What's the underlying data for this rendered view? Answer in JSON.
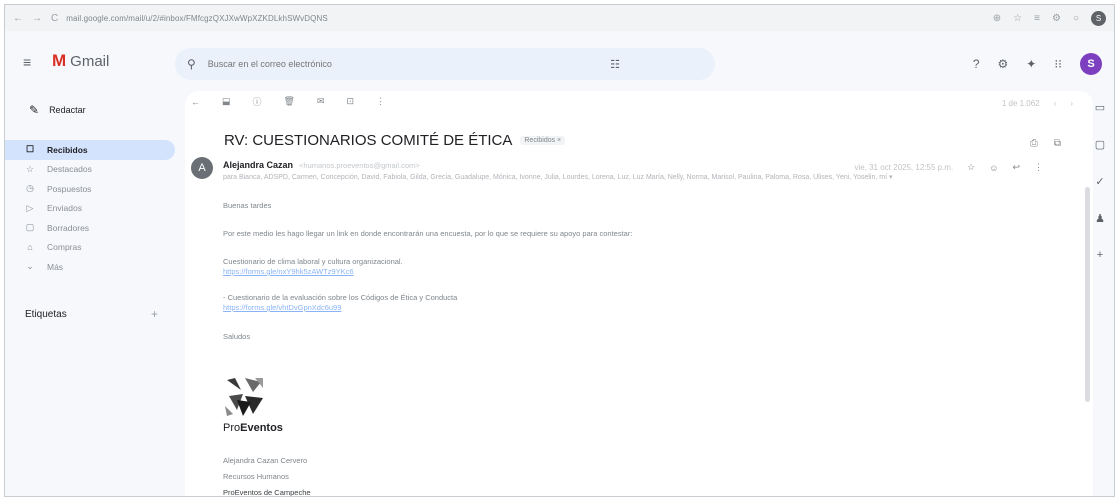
{
  "browser": {
    "url": "mail.google.com/mail/u/2/#inbox/FMfcgzQXJXwWpXZKDLkhSWvDQNS",
    "nav": [
      "←",
      "→",
      "C"
    ],
    "tools": [
      "⊕",
      "☆",
      "≡",
      "⚙",
      "○"
    ],
    "profile": "S"
  },
  "header": {
    "app_name": "Gmail",
    "search_placeholder": "Buscar en el correo electrónico",
    "user_initial": "S"
  },
  "sidebar": {
    "compose_label": "Redactar",
    "items": [
      {
        "icon": "☐",
        "label": "Recibidos"
      },
      {
        "icon": "☆",
        "label": "Destacados"
      },
      {
        "icon": "◷",
        "label": "Pospuestos"
      },
      {
        "icon": "▷",
        "label": "Enviados"
      },
      {
        "icon": "▢",
        "label": "Borradores"
      },
      {
        "icon": "⌂",
        "label": "Compras"
      },
      {
        "icon": "⌄",
        "label": "Más"
      }
    ],
    "labels_heading": "Etiquetas",
    "labels_add": "+"
  },
  "toolbar": {
    "back": "←",
    "actions": [
      "⬓",
      "ⓘ",
      "🗑",
      "✉",
      "⊡",
      "⋮"
    ],
    "pager_text": "1 de 1.062",
    "prev": "‹",
    "next": "›"
  },
  "message": {
    "subject": "RV: CUESTIONARIOS COMITÉ DE ÉTICA",
    "label_chip": "Recibidos ×",
    "sender_initial": "A",
    "sender_name": "Alejandra Cazan",
    "sender_email": "<humanos.proeventos@gmail.com>",
    "date": "vie, 31 oct 2025, 12:55 p.m.",
    "to_line": "para Bianca, ADSPD, Carmen, Concepción, David, Fabiola, Gilda, Grecia, Guadalupe, Mónica, Ivonne, Julia, Lourdes, Lorena, Luz, Luz María, Nelly, Norma, Marisol, Paulina, Paloma, Rosa, Ulises, Yeni, Yoselin, mí ▾",
    "body": {
      "greeting": "Buenas tardes",
      "intro": "Por este medio les hago llegar un link en donde encontrarán una encuesta, por lo que se requiere su apoyo para contestar:",
      "q1_title": "Cuestionario de clima laboral y cultura organizacional.",
      "q1_link": "https://forms.gle/nxY9hk5zAWTz9YKc6",
      "q2_title": "- Cuestionario de la evaluación sobre los Códigos de Ética y Conducta",
      "q2_link": "https://forms.gle/vhtDvGpnXdc6u99",
      "closing": "Saludos"
    },
    "signature": {
      "brand_plain": "Pro",
      "brand_bold": "Eventos",
      "name": "Alejandra Cazan Cervero",
      "role": "Recursos Humanos",
      "company": "ProEventos de Campeche"
    }
  },
  "side_panel": [
    "▭",
    "▢",
    "✓",
    "♟",
    "+"
  ]
}
